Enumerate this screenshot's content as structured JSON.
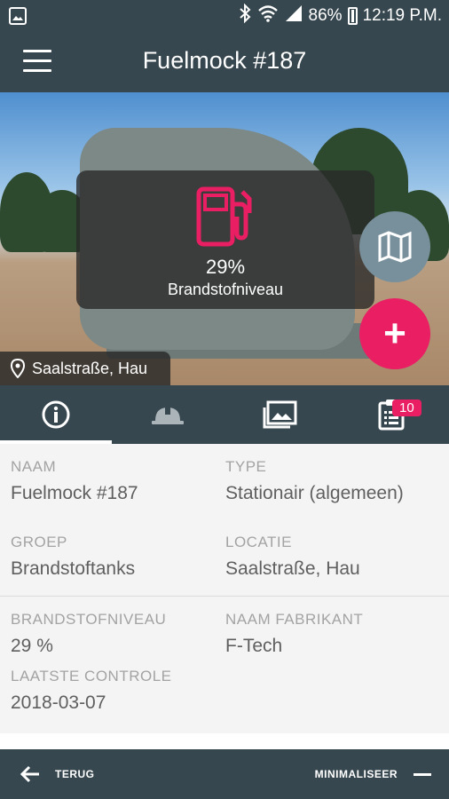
{
  "status_bar": {
    "battery": "86%",
    "time": "12:19 P.M."
  },
  "app_bar": {
    "title": "Fuelmock #187"
  },
  "hero": {
    "fuel_percent": "29%",
    "fuel_label": "Brandstofniveau",
    "location": "Saalstraße, Hau"
  },
  "tabs": [
    {
      "name": "info",
      "icon": "info-icon",
      "active": true
    },
    {
      "name": "maintenance",
      "icon": "hardhat-icon",
      "active": false
    },
    {
      "name": "gallery",
      "icon": "gallery-icon",
      "active": false
    },
    {
      "name": "checklist",
      "icon": "clipboard-icon",
      "active": false,
      "badge": "10"
    }
  ],
  "details": {
    "naam": {
      "label": "NAAM",
      "value": "Fuelmock #187"
    },
    "type": {
      "label": "TYPE",
      "value": "Stationair (algemeen)"
    },
    "groep": {
      "label": "GROEP",
      "value": "Brandstoftanks"
    },
    "locatie": {
      "label": "LOCATIE",
      "value": "Saalstraße, Hau"
    },
    "brandstofniveau": {
      "label": "BRANDSTOFNIVEAU",
      "value": "29 %"
    },
    "fabrikant": {
      "label": "NAAM FABRIKANT",
      "value": "F-Tech"
    },
    "laatste_controle": {
      "label": "LAATSTE CONTROLE",
      "value": "2018-03-07"
    }
  },
  "bottom_bar": {
    "back_label": "TERUG",
    "minimize_label": "MINIMALISEER"
  },
  "colors": {
    "primary": "#37474f",
    "accent": "#e91e63",
    "secondary_fab": "#78909c"
  }
}
